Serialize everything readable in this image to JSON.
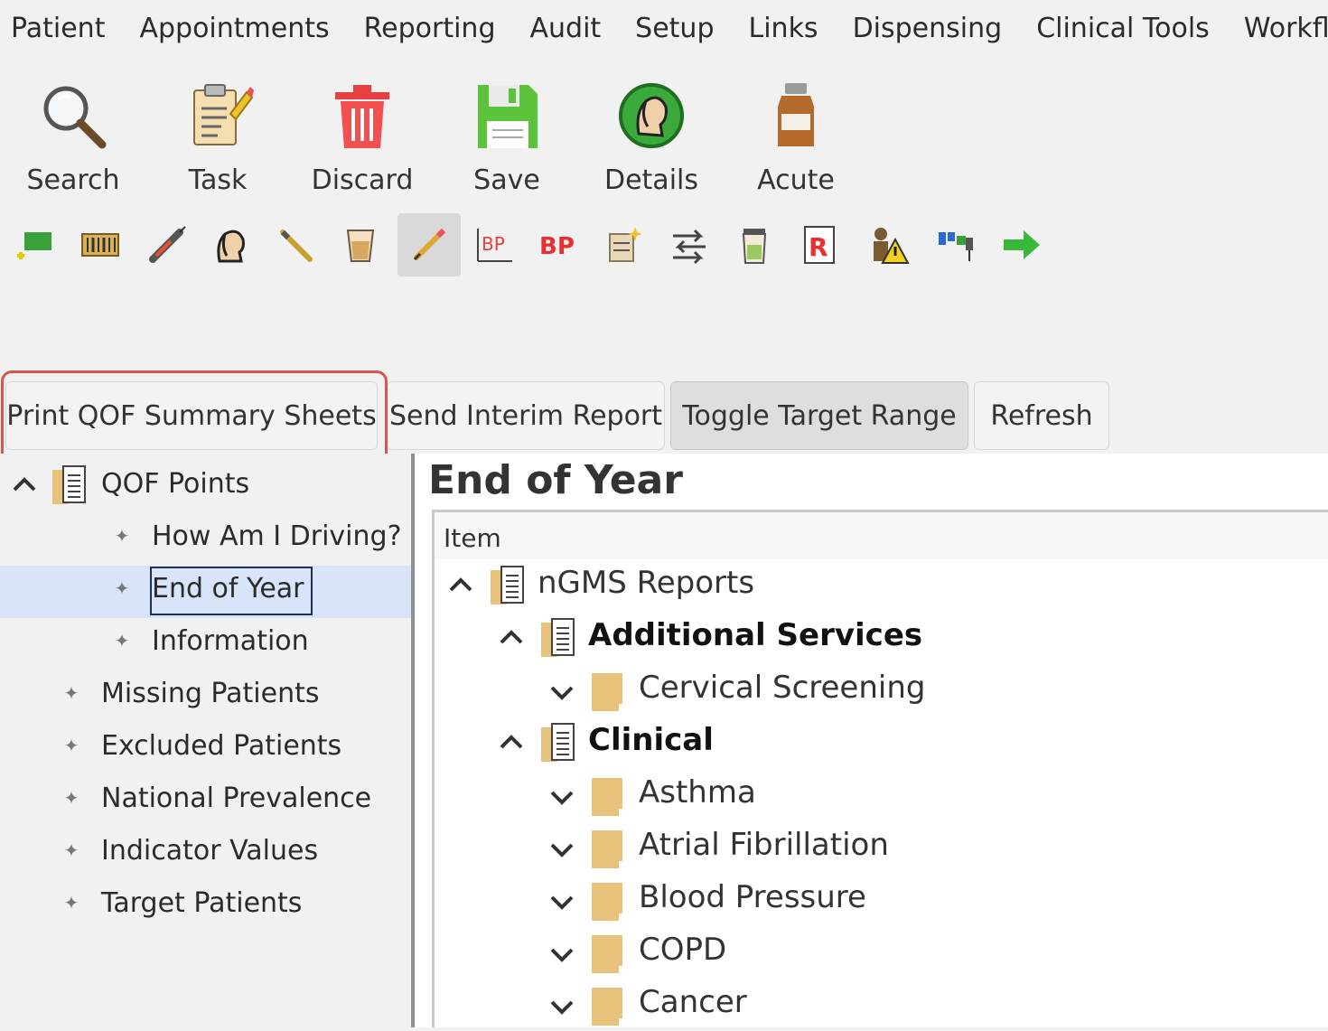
{
  "menu": [
    "Patient",
    "Appointments",
    "Reporting",
    "Audit",
    "Setup",
    "Links",
    "Dispensing",
    "Clinical Tools",
    "Workflow"
  ],
  "toolbar_large": [
    {
      "label": "Search",
      "icon": "magnifier-icon"
    },
    {
      "label": "Task",
      "icon": "task-clipboard-icon"
    },
    {
      "label": "Discard",
      "icon": "trash-icon"
    },
    {
      "label": "Save",
      "icon": "floppy-disk-icon"
    },
    {
      "label": "Details",
      "icon": "patient-details-icon"
    },
    {
      "label": "Acute",
      "icon": "medicine-bottle-icon"
    }
  ],
  "toolbar_small_icons": [
    "add-note-icon",
    "barcode-icon",
    "syringe-icon",
    "patient-head-icon",
    "pen-icon",
    "cup-icon",
    "edit-pencil-icon",
    "bp-chart-icon",
    "bp-icon",
    "sparkle-form-icon",
    "transfer-arrows-icon",
    "specimen-jar-icon",
    "prescription-icon",
    "warning-person-icon",
    "chart-blocks-icon",
    "arrow-right-icon"
  ],
  "toolbar_small_bp_text": "BP",
  "toolbar_small_rx_text": "R",
  "actions": {
    "print_qof": "Print QOF Summary Sheets",
    "send_interim": "Send Interim Report",
    "toggle_target": "Toggle Target Range",
    "refresh": "Refresh"
  },
  "left_tree": {
    "root": "QOF Points",
    "children": [
      "How Am I Driving?",
      "End of Year",
      "Information"
    ],
    "siblings": [
      "Missing Patients",
      "Excluded Patients",
      "National Prevalence",
      "Indicator Values",
      "Target Patients"
    ]
  },
  "right": {
    "title": "End of Year",
    "column_header": "Item",
    "root": "nGMS Reports",
    "groups": [
      {
        "name": "Additional Services",
        "items": [
          "Cervical Screening"
        ]
      },
      {
        "name": "Clinical",
        "items": [
          "Asthma",
          "Atrial Fibrillation",
          "Blood Pressure",
          "COPD",
          "Cancer"
        ]
      }
    ]
  },
  "colors": {
    "highlight": "#d9544a",
    "selection": "#d7e4fa",
    "folder": "#e8c27a"
  }
}
